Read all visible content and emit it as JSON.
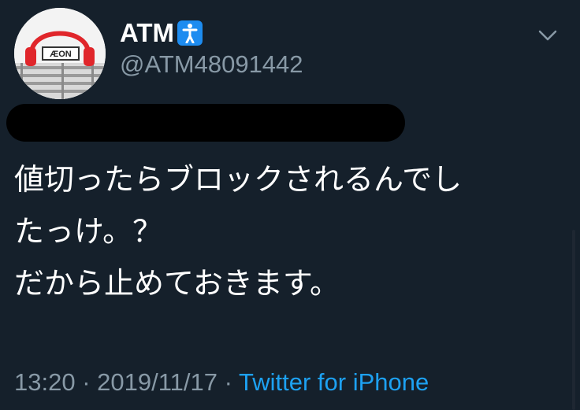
{
  "tweet": {
    "display_name": "ATM",
    "badge_icon": "person-icon",
    "handle": "@ATM48091442",
    "avatar_logo_text": "ÆON",
    "text_lines": [
      "値切ったらブロックされるんでし",
      "たっけ。？",
      "だから止めておきます。"
    ],
    "time": "13:20",
    "separator": "·",
    "date": "2019/11/17",
    "source": "Twitter for iPhone"
  },
  "colors": {
    "background": "#15202b",
    "text": "#ffffff",
    "muted": "#8899a6",
    "link": "#1da1f2",
    "badge": "#1d8cf0",
    "headphones": "#e0262b"
  }
}
